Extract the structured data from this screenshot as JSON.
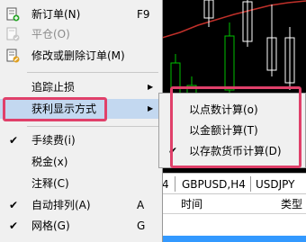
{
  "menu": {
    "items": [
      {
        "label": "新订单(N)",
        "shortcut": "F9",
        "icon": "new-order-icon"
      },
      {
        "label": "平仓(O)",
        "disabled": true,
        "icon": "close-position-icon"
      },
      {
        "label": "修改或删除订单(M)",
        "icon": "modify-order-icon"
      },
      {
        "label": "追踪止损",
        "submenu": true
      },
      {
        "label": "获利显示方式",
        "submenu": true,
        "highlighted": true
      },
      {
        "label": "手续费(i)",
        "checked": true
      },
      {
        "label": "税金(x)"
      },
      {
        "label": "注释(C)"
      },
      {
        "label": "自动排列(A)",
        "shortcut": "A",
        "checked": true
      },
      {
        "label": "网格(G)",
        "shortcut": "G",
        "checked": true
      }
    ],
    "arrow_glyph": "▶",
    "check_glyph": "✔"
  },
  "submenu": {
    "items": [
      {
        "label": "以点数计算(o)"
      },
      {
        "label": "以金额计算(T)"
      },
      {
        "label": "以存款货币计算(D)",
        "checked": true
      }
    ]
  },
  "background": {
    "chart_tabs": [
      "4",
      "GBPUSD,H4",
      "USDJPY"
    ],
    "grid_columns": [
      "时间",
      "类型"
    ]
  },
  "colors": {
    "highlight_box": "#e0406a",
    "menu_bg": "#f0f0f0",
    "selection": "#c3d8f0",
    "chart_bg": "#000000",
    "chart_line": "#c0302a",
    "candle_up": "#00c000"
  }
}
